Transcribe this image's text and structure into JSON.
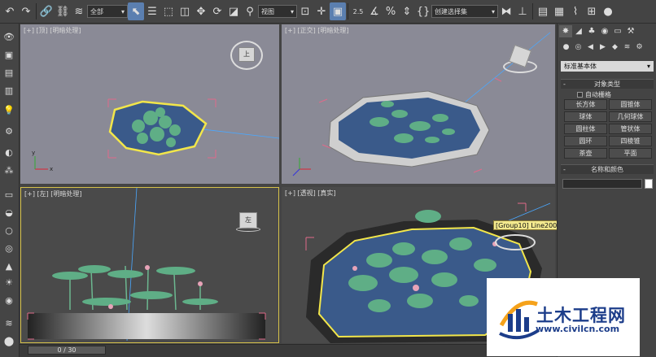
{
  "toolbar": {
    "selection_filter": "全部",
    "ref_coord": "视图",
    "angle_snap_label": "2.5",
    "create_selection_set": "创建选择集"
  },
  "viewports": {
    "top": {
      "label": "[+] [顶] [明暗处理]",
      "cube_face": "上"
    },
    "front": {
      "label": "[+] [正交] [明暗处理]"
    },
    "left": {
      "label": "[+] [左] [明暗处理]",
      "cube_face": "左"
    },
    "persp": {
      "label": "[+] [透视] [真实]"
    }
  },
  "tooltip": "[Group10] Line200",
  "command_panel": {
    "category_dropdown": "标准基本体",
    "rollout_object_type": "对象类型",
    "autogrid": "自动栅格",
    "buttons": [
      "长方体",
      "圆锥体",
      "球体",
      "几何球体",
      "圆柱体",
      "管状体",
      "圆环",
      "四棱锥",
      "茶壶",
      "平面"
    ],
    "rollout_name_color": "名称和颜色",
    "rollout_toggle": "-"
  },
  "timeline": {
    "frame": "0 / 30"
  },
  "watermark": {
    "title": "土木工程网",
    "url": "www.civilcn.com"
  },
  "colors": {
    "viewport_bg": "#8a8a96",
    "viewport_dark": "#4a4a4a",
    "active_border": "#d7c24a",
    "select_yellow": "#f2e64a",
    "water": "#3a5a8a",
    "leaf": "#5fae86",
    "brand_blue": "#1c3d8a"
  }
}
